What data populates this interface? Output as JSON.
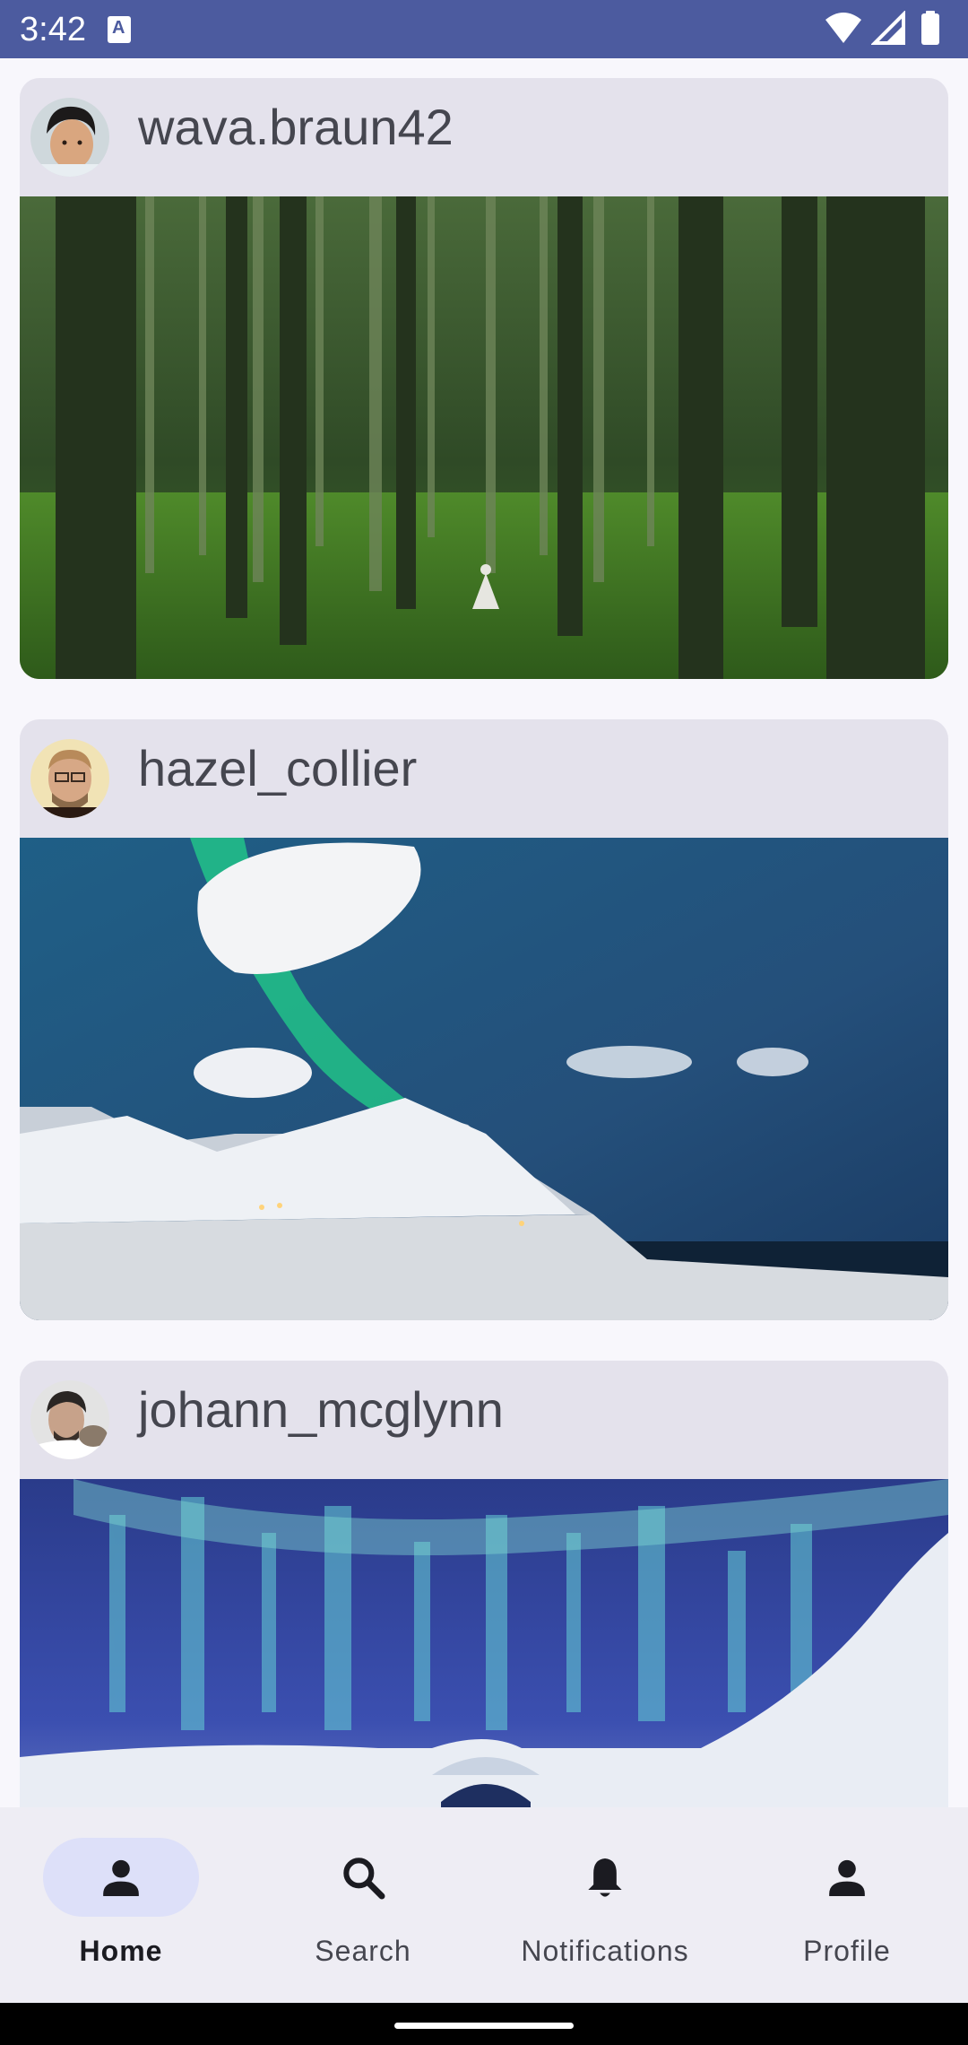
{
  "status_bar": {
    "time": "3:42",
    "icons": [
      "text-notification-icon",
      "wifi-icon",
      "cellular-signal-icon",
      "battery-icon"
    ]
  },
  "feed": {
    "posts": [
      {
        "username": "wava.braun42",
        "avatar": "avatar-photo",
        "image": "forest-photo"
      },
      {
        "username": "hazel_collier",
        "avatar": "avatar-photo",
        "image": "aurora-mountain-photo"
      },
      {
        "username": "johann_mcglynn",
        "avatar": "avatar-photo",
        "image": "aurora-igloo-photo"
      }
    ]
  },
  "bottom_nav": {
    "items": [
      {
        "label": "Home",
        "icon": "person-icon",
        "selected": true
      },
      {
        "label": "Search",
        "icon": "search-icon",
        "selected": false
      },
      {
        "label": "Notifications",
        "icon": "bell-icon",
        "selected": false
      },
      {
        "label": "Profile",
        "icon": "person-icon",
        "selected": false
      }
    ]
  },
  "colors": {
    "status_bar": "#4c5b9f",
    "card_background": "#e4e2ec",
    "page_background": "#f8f7fc",
    "nav_background": "#eeedf4",
    "nav_selected_pill": "#dde0f9",
    "text": "#45464f"
  }
}
